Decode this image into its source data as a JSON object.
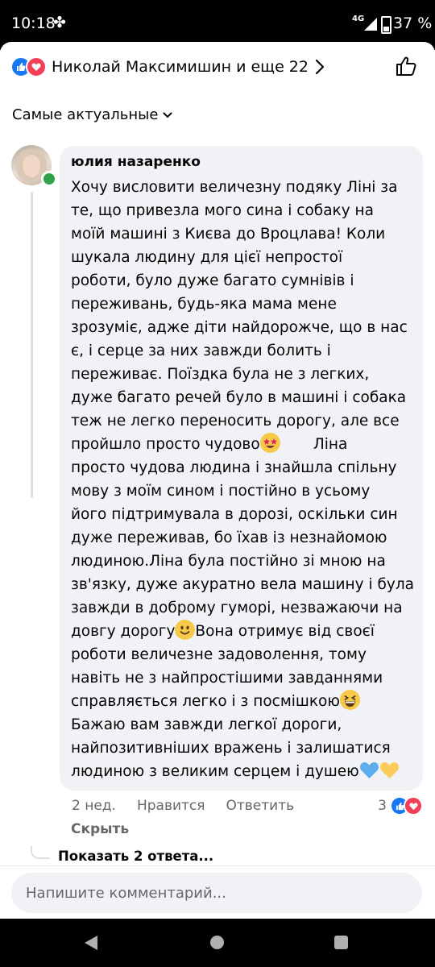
{
  "status_bar": {
    "time": "10:18",
    "network": "4G",
    "battery": "37 %"
  },
  "reactions_summary": {
    "text": "Николай Максимишин и еще 22"
  },
  "sort": {
    "label": "Самые актуальные"
  },
  "comment": {
    "author": "юлия назаренко",
    "lines": [
      [
        "Хочу висловити величезну подяку Ліні за"
      ],
      [
        "те, що привезла мого сина і собаку на"
      ],
      [
        "моїй машині з Києва до Вроцлава! Коли"
      ],
      [
        "шукала людину для цієї непростої"
      ],
      [
        "роботи, було дуже багато сумнівів і"
      ],
      [
        "переживань, будь-яка мама мене"
      ],
      [
        "зрозуміє, адже діти найдорожче, що в нас"
      ],
      [
        "є, і серце за них завжди болить і"
      ],
      [
        "переживає. Поїздка була не з легких,"
      ],
      [
        "дуже багато речей було в машині і собака"
      ],
      [
        "теж не легко переносить дорогу, але все"
      ],
      [
        "пройшло просто чудово",
        "       Ліна"
      ],
      [
        "просто чудова людина і знайшла спільну"
      ],
      [
        "мову з моїм сином і постійно в усьому"
      ],
      [
        "його підтримувала в дорозі, оскільки син"
      ],
      [
        "дуже переживав, бо їхав із незнайомою"
      ],
      [
        "людиною.Ліна була постійно зі мною на"
      ],
      [
        "зв'язку, дуже акуратно вела машину і була"
      ],
      [
        "завжди в доброму гуморі, незважаючи на"
      ],
      [
        "довгу дорогу",
        "Вона отримує від своєї"
      ],
      [
        "роботи величезне задоволення, тому"
      ],
      [
        "навіть не з найпростішими завданнями"
      ],
      [
        "справляється легко і з посмішкою"
      ],
      [
        "Бажаю вам завжди легкої дороги,"
      ],
      [
        "найпозитивніших вражень і залишатися"
      ],
      [
        "людиною з великим серцем і душею"
      ]
    ],
    "emojis": {
      "star_struck": "star-struck-emoji",
      "smile": "smiling-face-emoji",
      "grin": "grinning-squinting-face-emoji",
      "blue_heart": "blue-heart-emoji",
      "yellow_heart": "yellow-heart-emoji"
    },
    "time": "2 нед.",
    "like_label": "Нравится",
    "reply_label": "Ответить",
    "reaction_count": "3",
    "hide_label": "Скрыть",
    "show_replies_label": "Показать 2 ответа..."
  },
  "composer": {
    "placeholder": "Напишите комментарий..."
  },
  "colors": {
    "accent": "#1877f2",
    "love": "#f33e58",
    "online": "#31a24c",
    "bubble": "#f0f2f5",
    "secondary_text": "#65676b"
  }
}
